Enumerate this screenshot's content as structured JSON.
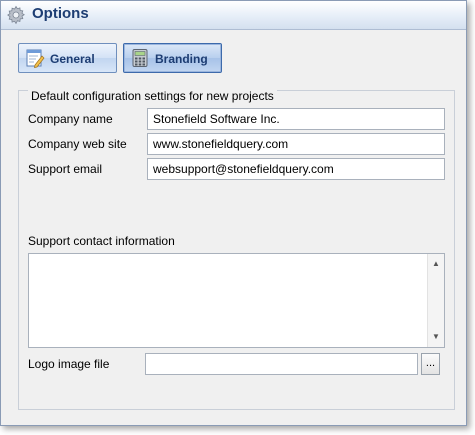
{
  "window": {
    "title": "Options"
  },
  "tabs": [
    {
      "label": "General",
      "icon": "form-edit-icon"
    },
    {
      "label": "Branding",
      "icon": "calculator-icon"
    }
  ],
  "group": {
    "caption": "Default configuration settings for new projects"
  },
  "fields": {
    "company_name": {
      "label": "Company name",
      "value": "Stonefield Software Inc."
    },
    "company_web_site": {
      "label": "Company web site",
      "value": "www.stonefieldquery.com"
    },
    "support_email": {
      "label": "Support email",
      "value": "websupport@stonefieldquery.com"
    },
    "support_contact": {
      "label": "Support contact information",
      "value": ""
    },
    "logo_image_file": {
      "label": "Logo image file",
      "value": "",
      "browse_label": "..."
    }
  },
  "colors": {
    "title_text": "#1d3d73",
    "window_bg": "#f0f0f0",
    "tab_border": "#6f8fbd"
  }
}
